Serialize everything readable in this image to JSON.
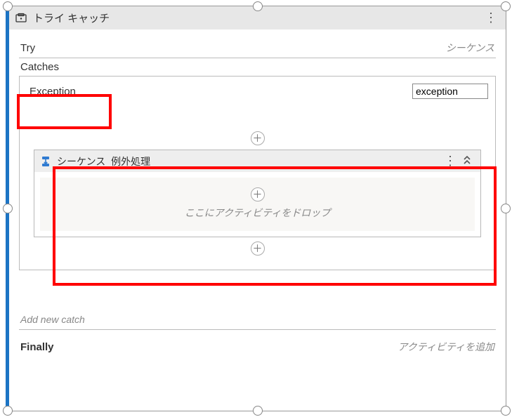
{
  "title": "トライ キャッチ",
  "try": {
    "label": "Try",
    "hint": "シーケンス"
  },
  "catches": {
    "label": "Catches",
    "items": [
      {
        "type": "Exception",
        "varName": "exception",
        "sequenceTitle": "シーケンス_例外処理",
        "dropHint": "ここにアクティビティをドロップ"
      }
    ],
    "addNew": "Add new catch"
  },
  "finally": {
    "label": "Finally",
    "hint": "アクティビティを追加"
  }
}
